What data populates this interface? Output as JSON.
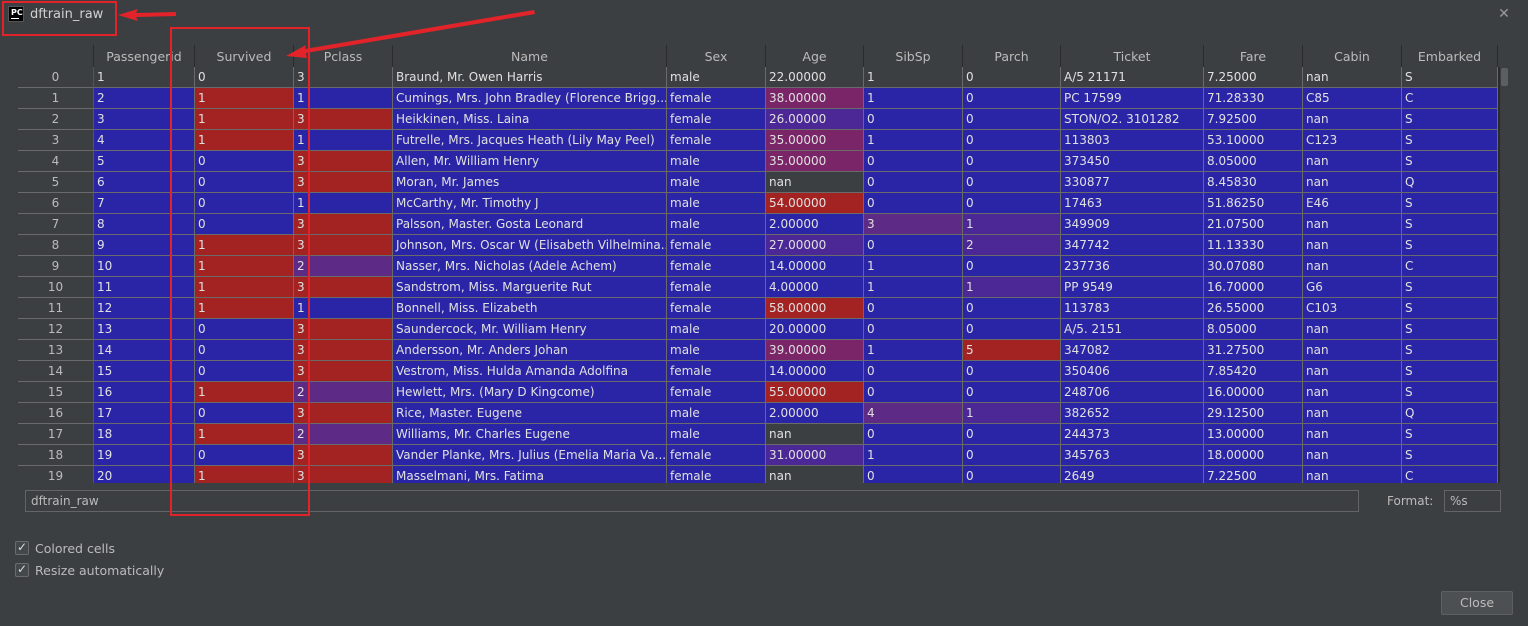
{
  "window": {
    "title": "dftrain_raw",
    "app_icon_text": "PC"
  },
  "table": {
    "columns": [
      "Passengerid",
      "Survived",
      "Pclass",
      "Name",
      "Sex",
      "Age",
      "SibSp",
      "Parch",
      "Ticket",
      "Fare",
      "Cabin",
      "Embarked"
    ],
    "rows": [
      {
        "index": "0",
        "cells": [
          "1",
          "0",
          "3",
          "Braund, Mr. Owen Harris",
          "male",
          "22.00000",
          "1",
          "0",
          "A/5 21171",
          "7.25000",
          "nan",
          "S"
        ]
      },
      {
        "index": "1",
        "cells": [
          "2",
          "1",
          "1",
          "Cumings, Mrs. John Bradley (Florence Brigg...",
          "female",
          "38.00000",
          "1",
          "0",
          "PC 17599",
          "71.28330",
          "C85",
          "C"
        ]
      },
      {
        "index": "2",
        "cells": [
          "3",
          "1",
          "3",
          "Heikkinen, Miss. Laina",
          "female",
          "26.00000",
          "0",
          "0",
          "STON/O2. 3101282",
          "7.92500",
          "nan",
          "S"
        ]
      },
      {
        "index": "3",
        "cells": [
          "4",
          "1",
          "1",
          "Futrelle, Mrs. Jacques Heath (Lily May Peel)",
          "female",
          "35.00000",
          "1",
          "0",
          "113803",
          "53.10000",
          "C123",
          "S"
        ]
      },
      {
        "index": "4",
        "cells": [
          "5",
          "0",
          "3",
          "Allen, Mr. William Henry",
          "male",
          "35.00000",
          "0",
          "0",
          "373450",
          "8.05000",
          "nan",
          "S"
        ]
      },
      {
        "index": "5",
        "cells": [
          "6",
          "0",
          "3",
          "Moran, Mr. James",
          "male",
          "nan",
          "0",
          "0",
          "330877",
          "8.45830",
          "nan",
          "Q"
        ]
      },
      {
        "index": "6",
        "cells": [
          "7",
          "0",
          "1",
          "McCarthy, Mr. Timothy J",
          "male",
          "54.00000",
          "0",
          "0",
          "17463",
          "51.86250",
          "E46",
          "S"
        ]
      },
      {
        "index": "7",
        "cells": [
          "8",
          "0",
          "3",
          "Palsson, Master. Gosta Leonard",
          "male",
          "2.00000",
          "3",
          "1",
          "349909",
          "21.07500",
          "nan",
          "S"
        ]
      },
      {
        "index": "8",
        "cells": [
          "9",
          "1",
          "3",
          "Johnson, Mrs. Oscar W (Elisabeth Vilhelmina...",
          "female",
          "27.00000",
          "0",
          "2",
          "347742",
          "11.13330",
          "nan",
          "S"
        ]
      },
      {
        "index": "9",
        "cells": [
          "10",
          "1",
          "2",
          "Nasser, Mrs. Nicholas (Adele Achem)",
          "female",
          "14.00000",
          "1",
          "0",
          "237736",
          "30.07080",
          "nan",
          "C"
        ]
      },
      {
        "index": "10",
        "cells": [
          "11",
          "1",
          "3",
          "Sandstrom, Miss. Marguerite Rut",
          "female",
          "4.00000",
          "1",
          "1",
          "PP 9549",
          "16.70000",
          "G6",
          "S"
        ]
      },
      {
        "index": "11",
        "cells": [
          "12",
          "1",
          "1",
          "Bonnell, Miss. Elizabeth",
          "female",
          "58.00000",
          "0",
          "0",
          "113783",
          "26.55000",
          "C103",
          "S"
        ]
      },
      {
        "index": "12",
        "cells": [
          "13",
          "0",
          "3",
          "Saundercock, Mr. William Henry",
          "male",
          "20.00000",
          "0",
          "0",
          "A/5. 2151",
          "8.05000",
          "nan",
          "S"
        ]
      },
      {
        "index": "13",
        "cells": [
          "14",
          "0",
          "3",
          "Andersson, Mr. Anders Johan",
          "male",
          "39.00000",
          "1",
          "5",
          "347082",
          "31.27500",
          "nan",
          "S"
        ]
      },
      {
        "index": "14",
        "cells": [
          "15",
          "0",
          "3",
          "Vestrom, Miss. Hulda Amanda Adolfina",
          "female",
          "14.00000",
          "0",
          "0",
          "350406",
          "7.85420",
          "nan",
          "S"
        ]
      },
      {
        "index": "15",
        "cells": [
          "16",
          "1",
          "2",
          "Hewlett, Mrs. (Mary D Kingcome)",
          "female",
          "55.00000",
          "0",
          "0",
          "248706",
          "16.00000",
          "nan",
          "S"
        ]
      },
      {
        "index": "16",
        "cells": [
          "17",
          "0",
          "3",
          "Rice, Master. Eugene",
          "male",
          "2.00000",
          "4",
          "1",
          "382652",
          "29.12500",
          "nan",
          "Q"
        ]
      },
      {
        "index": "17",
        "cells": [
          "18",
          "1",
          "2",
          "Williams, Mr. Charles Eugene",
          "male",
          "nan",
          "0",
          "0",
          "244373",
          "13.00000",
          "nan",
          "S"
        ]
      },
      {
        "index": "18",
        "cells": [
          "19",
          "0",
          "3",
          "Vander Planke, Mrs. Julius (Emelia Maria Va...",
          "female",
          "31.00000",
          "1",
          "0",
          "345763",
          "18.00000",
          "nan",
          "S"
        ]
      },
      {
        "index": "19",
        "cells": [
          "20",
          "1",
          "3",
          "Masselmani, Mrs. Fatima",
          "female",
          "nan",
          "0",
          "0",
          "2649",
          "7.22500",
          "nan",
          "C"
        ]
      }
    ],
    "cell_colors": {
      "low": "#2a25a6",
      "high": "#a32323",
      "mid": "#5d2a85",
      "none": "#3c3f41"
    }
  },
  "expression": {
    "value": "dftrain_raw"
  },
  "format": {
    "label": "Format:",
    "value": "%s"
  },
  "options": [
    {
      "label": "Colored cells",
      "checked": true
    },
    {
      "label": "Resize automatically",
      "checked": true
    }
  ],
  "buttons": {
    "close_label": "Close"
  },
  "annotation_color": "#e2242a"
}
